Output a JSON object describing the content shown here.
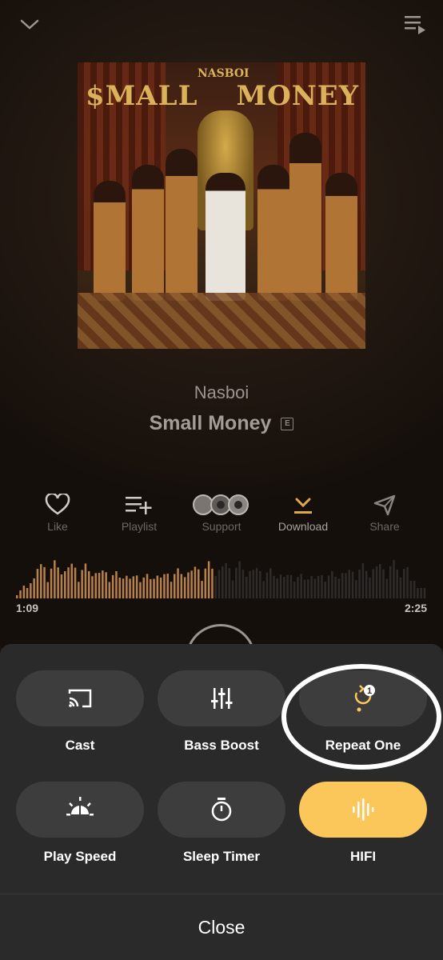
{
  "player": {
    "artist": "Nasboi",
    "title": "Small Money",
    "explicit_badge": "E",
    "cover": {
      "top_text": "NASBOI",
      "title_left": "$MALL",
      "title_right": "MONEY"
    },
    "actions": [
      {
        "label": "Like",
        "icon": "heart-icon"
      },
      {
        "label": "Playlist",
        "icon": "playlist-add-icon"
      },
      {
        "label": "Support",
        "icon": "support-avatars-icon"
      },
      {
        "label": "Download",
        "icon": "download-icon"
      },
      {
        "label": "Share",
        "icon": "share-icon"
      }
    ],
    "time_elapsed": "1:09",
    "time_total": "2:25",
    "progress": 0.48,
    "colors": {
      "accent": "#fcc75a",
      "wave_played": "#b8804a",
      "wave_rest": "#2e2c2a"
    }
  },
  "sheet": {
    "tiles": [
      {
        "label": "Cast",
        "icon": "cast-icon",
        "active": false
      },
      {
        "label": "Bass Boost",
        "icon": "equalizer-icon",
        "active": false
      },
      {
        "label": "Repeat One",
        "icon": "repeat-one-icon",
        "active": false,
        "badge": "1"
      },
      {
        "label": "Play Speed",
        "icon": "play-speed-icon",
        "active": false
      },
      {
        "label": "Sleep Timer",
        "icon": "timer-icon",
        "active": false
      },
      {
        "label": "HIFI",
        "icon": "hifi-wave-icon",
        "active": true
      }
    ],
    "close_label": "Close"
  }
}
